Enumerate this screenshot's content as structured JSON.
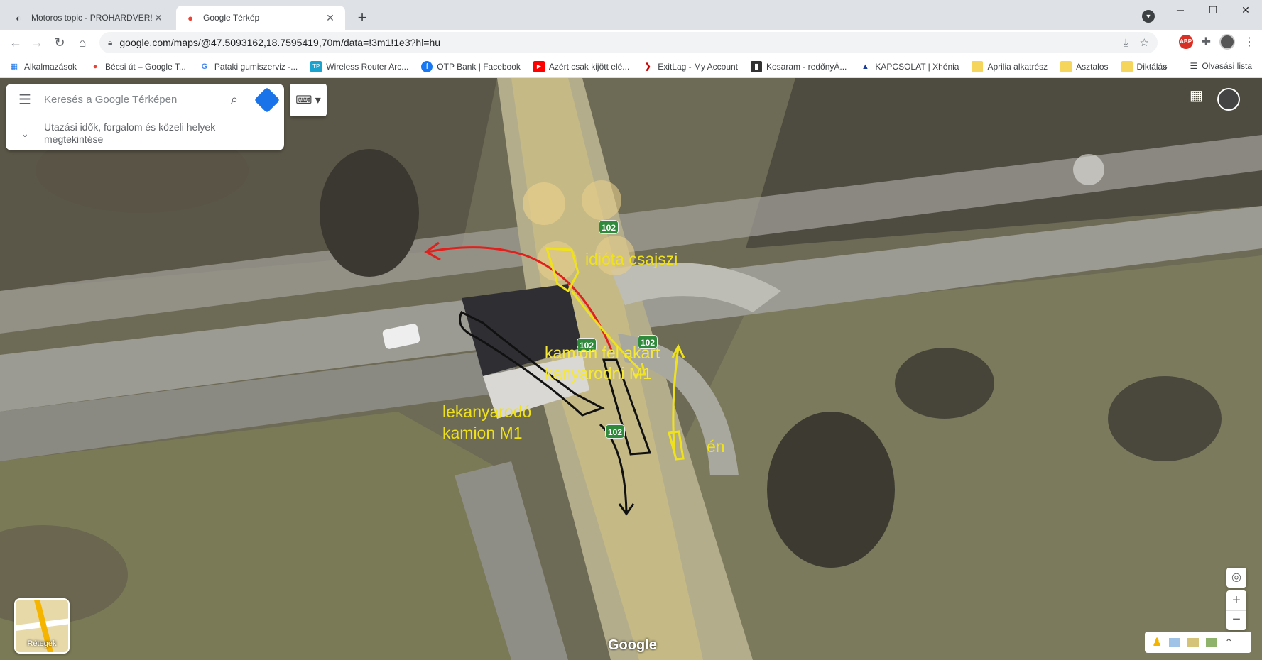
{
  "tabs": [
    {
      "title": "Motoros topic - PROHARDVER! H",
      "active": false,
      "icon": "prohardver-icon"
    },
    {
      "title": "Google Térkép",
      "active": true,
      "icon": "maps-pin-icon"
    }
  ],
  "address_bar": {
    "url": "google.com/maps/@47.5093162,18.7595419,70m/data=!3m1!1e3?hl=hu"
  },
  "bookmarks": [
    {
      "label": "Alkalmazások",
      "icon": "apps-grid-icon"
    },
    {
      "label": "Bécsi út – Google T...",
      "icon": "maps-pin-icon"
    },
    {
      "label": "Pataki gumiszerviz -...",
      "icon": "google-g-icon"
    },
    {
      "label": "Wireless Router Arc...",
      "icon": "tp-link-icon"
    },
    {
      "label": "OTP Bank | Facebook",
      "icon": "facebook-icon"
    },
    {
      "label": "Azért csak kijött elé...",
      "icon": "youtube-icon"
    },
    {
      "label": "ExitLag - My Account",
      "icon": "exitlag-icon"
    },
    {
      "label": "Kosaram - redőnyÁ...",
      "icon": "shop-icon"
    },
    {
      "label": "KAPCSOLAT | Xhénia",
      "icon": "xhenia-icon"
    },
    {
      "label": "Aprilia alkatrész",
      "icon": "folder-icon"
    },
    {
      "label": "Asztalos",
      "icon": "folder-icon"
    },
    {
      "label": "Diktálás",
      "icon": "folder-icon"
    }
  ],
  "bookmarks_more": "»",
  "reading_list": "Olvasási lista",
  "search": {
    "placeholder": "Keresés a Google Térképen",
    "hint": "Utazási idők, forgalom és közeli helyek megtekintése"
  },
  "layers_label": "Rétegek",
  "google_logo": "Google",
  "route_shields": [
    "102",
    "102",
    "102",
    "102"
  ],
  "annotations": {
    "idiot": "idióta csajszi",
    "truck_wanted_line1": "kamion fel akart",
    "truck_wanted_line2": "kanyarodni M1",
    "turning_line1": "lekanyarodó",
    "turning_line2": "kamion M1",
    "me": "én"
  },
  "colors": {
    "annotation_yellow": "#f0e21a",
    "annotation_red": "#e0201c",
    "annotation_black": "#111111",
    "shield_green": "#2f8a3b"
  }
}
